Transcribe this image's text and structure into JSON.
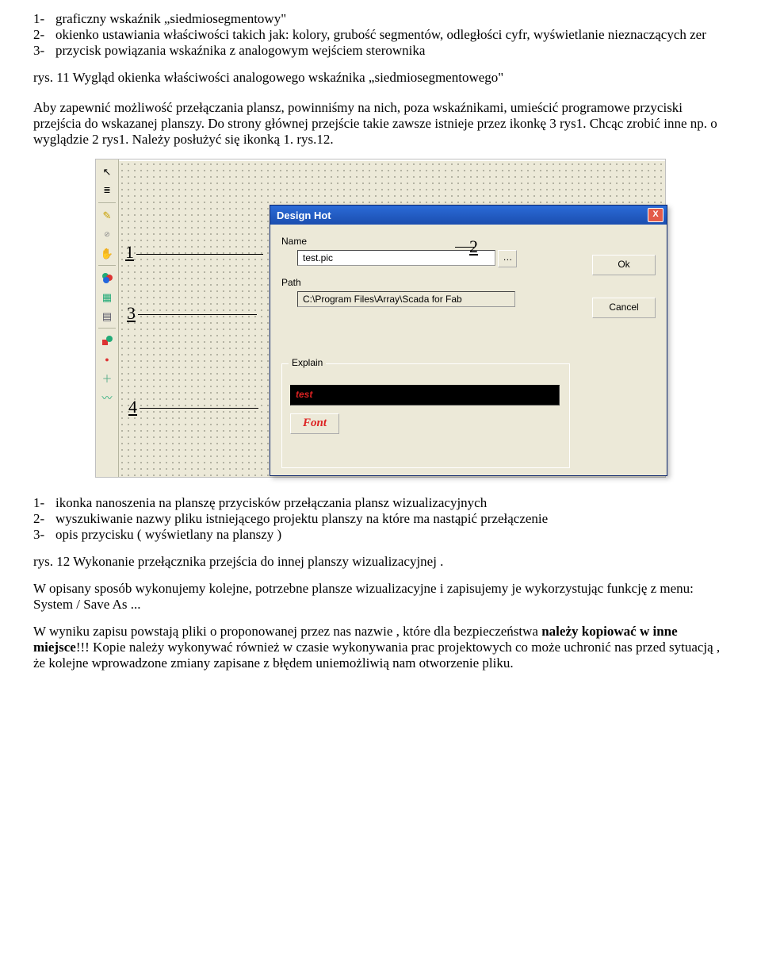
{
  "top_list": {
    "items": [
      {
        "num": "1-",
        "text": "graficzny wskaźnik „siedmiosegmentowy\""
      },
      {
        "num": "2-",
        "text": "okienko ustawiania właściwości takich jak: kolory, grubość segmentów, odległości cyfr, wyświetlanie nieznaczących zer"
      },
      {
        "num": "3-",
        "text": "przycisk powiązania wskaźnika z analogowym wejściem sterownika"
      }
    ]
  },
  "caption_top": "rys. 11 Wygląd okienka właściwości analogowego wskaźnika „siedmiosegmentowego\"",
  "para1": "Aby zapewnić możliwość  przełączania  plansz, powinniśmy na nich, poza wskaźnikami, umieścić programowe przyciski przejścia do wskazanej planszy. Do strony głównej przejście takie  zawsze istnieje przez ikonkę 3 rys1. Chcąc zrobić inne np. o wyglądzie 2 rys1. Należy posłużyć się ikonką  1. rys.12.",
  "dialog": {
    "title": "Design Hot",
    "name_label": "Name",
    "name_value": "test.pic",
    "browse": "…",
    "path_label": "Path",
    "path_value": "C:\\Program Files\\Array\\Scada for Fab",
    "explain_label": "Explain",
    "explain_value": "test",
    "font_btn": "Font",
    "ok": "Ok",
    "cancel": "Cancel",
    "close": "X"
  },
  "callouts": {
    "c1": "1",
    "c2": "2",
    "c3": "3",
    "c4": "4"
  },
  "mid_list": {
    "items": [
      {
        "num": "1-",
        "text": "ikonka nanoszenia na planszę przycisków przełączania plansz wizualizacyjnych"
      },
      {
        "num": "2-",
        "text": "wyszukiwanie nazwy pliku istniejącego projektu planszy na które ma nastąpić przełączenie"
      },
      {
        "num": "3-",
        "text": "opis przycisku  ( wyświetlany na planszy )"
      }
    ]
  },
  "caption_mid": "rys. 12  Wykonanie przełącznika przejścia do innej planszy wizualizacyjnej .",
  "para2": "W opisany sposób wykonujemy kolejne, potrzebne plansze wizualizacyjne i  zapisujemy je wykorzystując funkcję z menu:   System / Save As ...",
  "para3a": "W wyniku zapisu powstają pliki o proponowanej przez nas nazwie , które dla bezpieczeństwa ",
  "para3b": "należy kopiować w inne miejsce",
  "para3c": "!!! Kopie należy wykonywać również w czasie wykonywania  prac projektowych co może uchronić nas przed sytuacją , że  kolejne wprowadzone zmiany zapisane z błędem uniemożliwią nam otworzenie pliku."
}
